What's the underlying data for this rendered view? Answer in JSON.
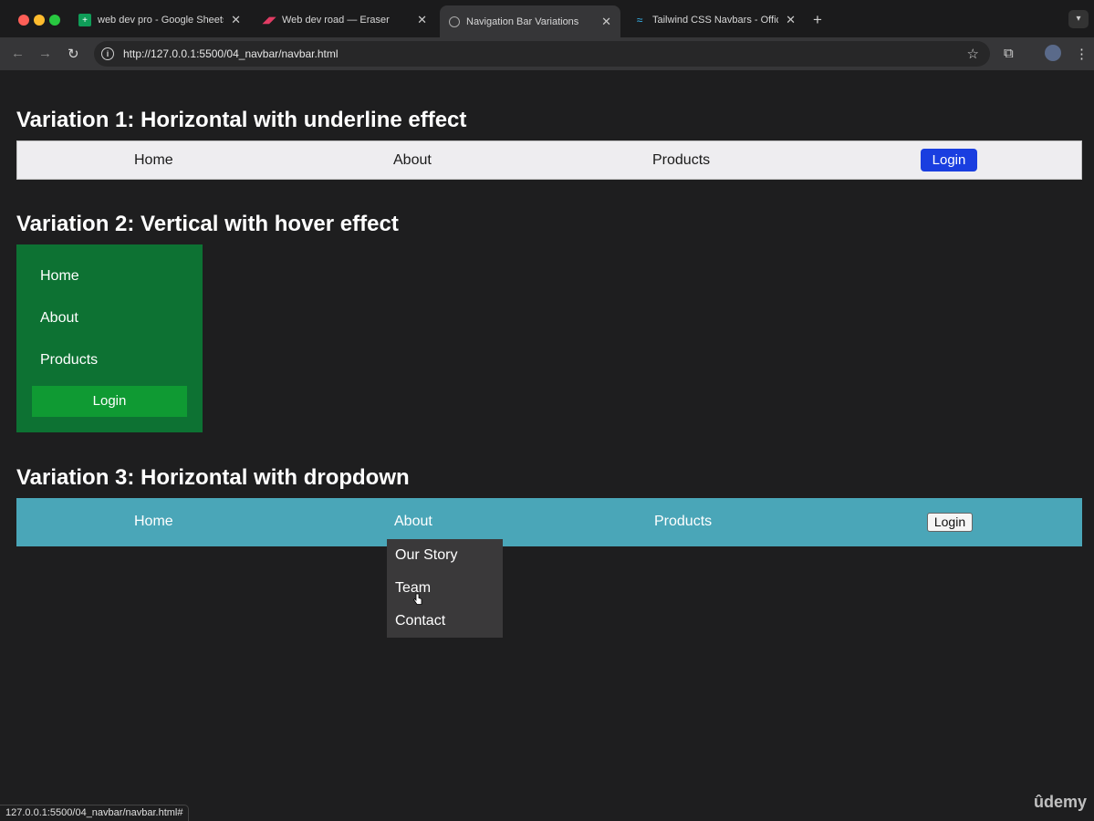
{
  "browser": {
    "tabs": [
      {
        "title": "web dev pro - Google Sheets",
        "icon": "sheets-icon"
      },
      {
        "title": "Web dev road — Eraser",
        "icon": "eraser-icon"
      },
      {
        "title": "Navigation Bar Variations",
        "icon": "globe-icon"
      },
      {
        "title": "Tailwind CSS Navbars - Offici",
        "icon": "tailwind-icon"
      }
    ],
    "active_tab": 2,
    "url": "http://127.0.0.1:5500/04_navbar/navbar.html"
  },
  "page": {
    "variation1": {
      "heading": "Variation 1: Horizontal with underline effect",
      "items": [
        "Home",
        "About",
        "Products"
      ],
      "login": "Login",
      "accent": "#1a3ee0"
    },
    "variation2": {
      "heading": "Variation 2: Vertical with hover effect",
      "items": [
        "Home",
        "About",
        "Products"
      ],
      "login": "Login",
      "background": "#0d7233"
    },
    "variation3": {
      "heading": "Variation 3: Horizontal with dropdown",
      "items": [
        "Home",
        "About",
        "Products"
      ],
      "login": "Login",
      "dropdown": [
        "Our Story",
        "Team",
        "Contact"
      ],
      "background": "#4aa6b8"
    }
  },
  "status_bar": {
    "url": "127.0.0.1:5500/04_navbar/navbar.html#"
  },
  "watermark": "ûdemy"
}
